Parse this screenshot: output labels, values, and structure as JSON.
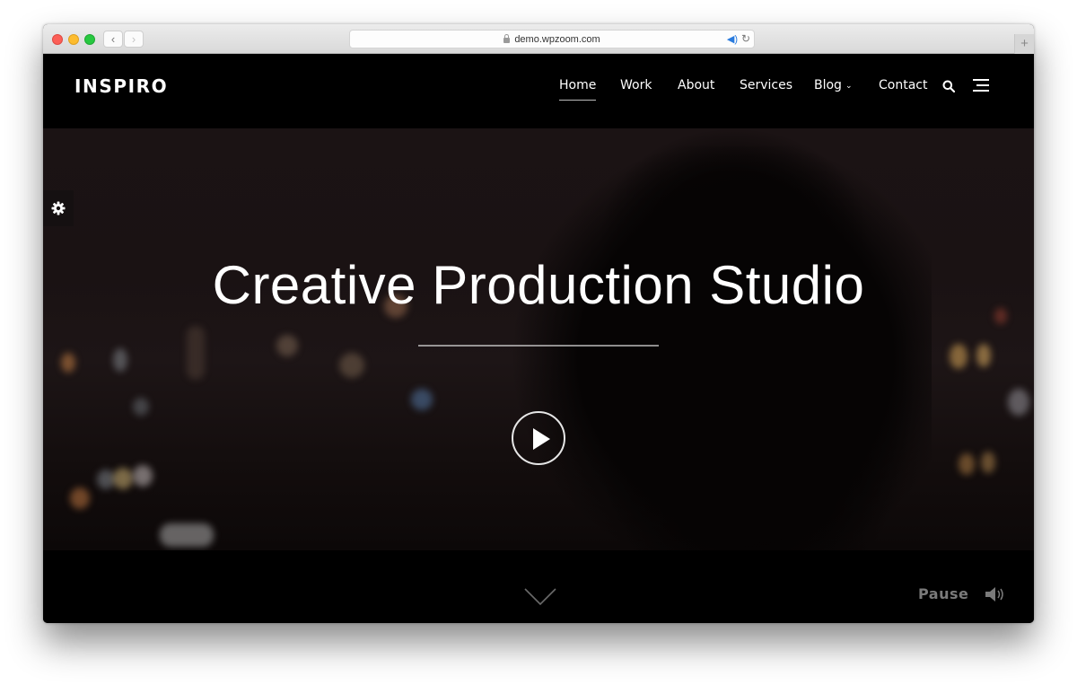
{
  "browser": {
    "url": "demo.wpzoom.com",
    "back_icon": "chevron-left-icon",
    "forward_icon": "chevron-right-icon",
    "new_tab_label": "+"
  },
  "site": {
    "logo": "INSPIRO",
    "nav": [
      {
        "label": "Home",
        "active": true
      },
      {
        "label": "Work"
      },
      {
        "label": "About"
      },
      {
        "label": "Services"
      },
      {
        "label": "Blog",
        "has_dropdown": true
      },
      {
        "label": "Contact"
      }
    ],
    "dropdown_glyph": "⌄"
  },
  "hero": {
    "title": "Creative Production Studio",
    "play_label": "Play video"
  },
  "footer": {
    "pause_label": "Pause"
  },
  "colors": {
    "header_bg": "#000000",
    "hero_bg": "#1a1213",
    "text": "#ffffff",
    "pause_text": "#7a7a7a"
  }
}
